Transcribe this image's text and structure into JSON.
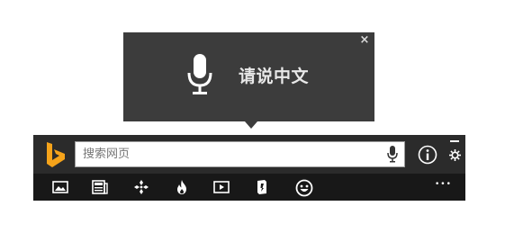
{
  "voice_popup": {
    "prompt": "请说中文",
    "close_label": "×"
  },
  "search": {
    "placeholder": "搜索网页",
    "value": ""
  },
  "toolbar": {
    "more_label": "•••",
    "items": [
      {
        "icon": "image-icon"
      },
      {
        "icon": "news-icon"
      },
      {
        "icon": "apps-icon"
      },
      {
        "icon": "trending-flame-icon"
      },
      {
        "icon": "video-icon"
      },
      {
        "icon": "dictionary-book-icon"
      },
      {
        "icon": "smiley-icon"
      }
    ]
  },
  "colors": {
    "popup_bg": "#3c3c3c",
    "bar_bg": "#2b2b2b",
    "toolbar_bg": "#181818",
    "logo_accent": "#f5a31a"
  }
}
